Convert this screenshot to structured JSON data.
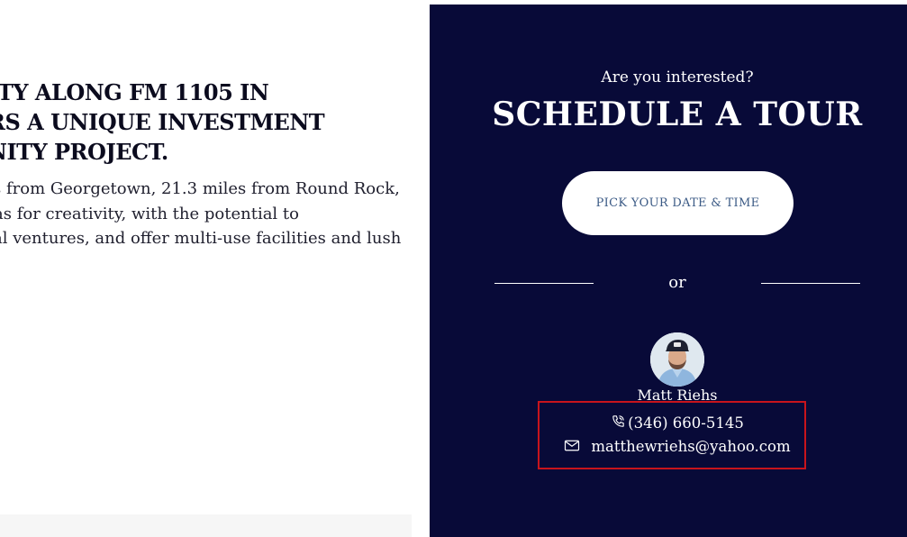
{
  "left": {
    "headline_lines": [
      "RTY ALONG FM 1105 IN",
      "RS A UNIQUE INVESTMENT",
      "NITY PROJECT."
    ],
    "body_lines": [
      "s from Georgetown, 21.3 miles from Round Rock,",
      "as for creativity, with the potential to",
      "al ventures, and offer multi-use facilities and lush"
    ]
  },
  "tour": {
    "prompt": "Are you interested?",
    "title": "SCHEDULE A TOUR",
    "button_label": "PICK YOUR DATE & TIME",
    "or_label": "or"
  },
  "agent": {
    "name": "Matt Riehs",
    "phone": "(346) 660-5145",
    "email": "matthewriehs@yahoo.com",
    "phone_icon": "phone-icon",
    "email_icon": "mail-icon"
  },
  "colors": {
    "panel_bg": "#080a38",
    "button_text": "#3b5a85",
    "highlight": "#c8141c"
  }
}
